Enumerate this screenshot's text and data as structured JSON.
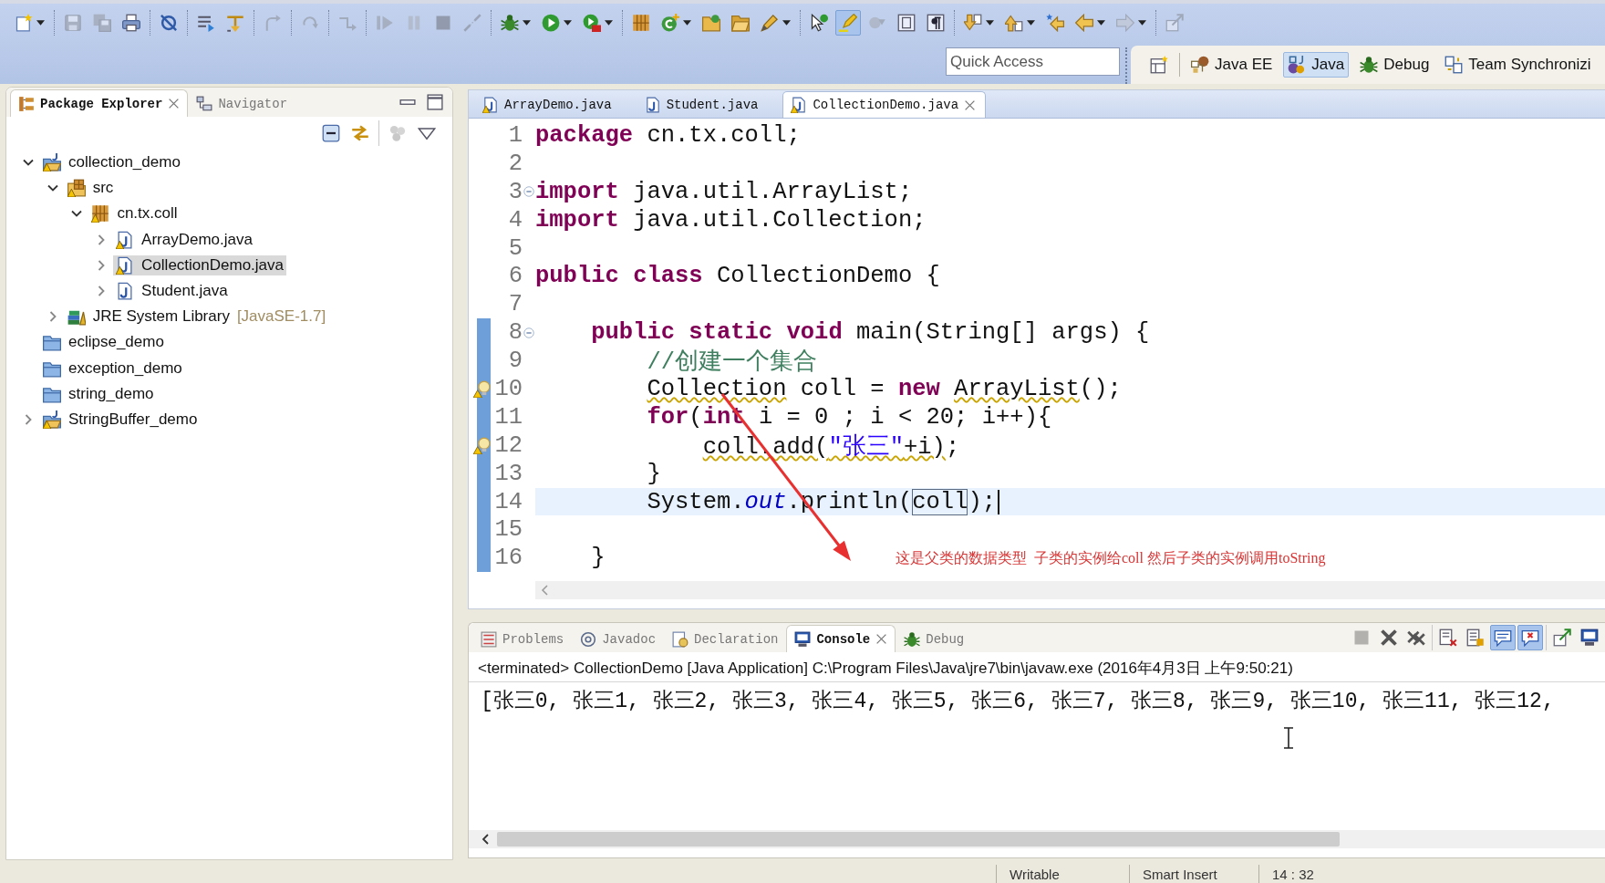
{
  "toolbar": {
    "groups": [
      [
        {
          "kind": "new",
          "dropdown": true,
          "disabled": false,
          "selected": false
        }
      ],
      [
        {
          "kind": "save",
          "dropdown": false,
          "disabled": true,
          "selected": false
        },
        {
          "kind": "save_all",
          "dropdown": false,
          "disabled": true,
          "selected": false
        },
        {
          "kind": "print",
          "dropdown": false,
          "disabled": false,
          "selected": false
        }
      ],
      [
        {
          "kind": "skip",
          "dropdown": false,
          "disabled": false,
          "selected": false
        }
      ],
      [
        {
          "kind": "lines",
          "dropdown": false,
          "disabled": false,
          "selected": false
        },
        {
          "kind": "branch",
          "dropdown": false,
          "disabled": false,
          "selected": false
        }
      ],
      [
        {
          "kind": "hook",
          "dropdown": false,
          "disabled": true,
          "selected": false
        }
      ],
      [
        {
          "kind": "redo",
          "dropdown": false,
          "disabled": true,
          "selected": false
        }
      ],
      [
        {
          "kind": "step_over",
          "dropdown": false,
          "disabled": true,
          "selected": false
        }
      ],
      [
        {
          "kind": "resume",
          "dropdown": false,
          "disabled": true,
          "selected": false
        },
        {
          "kind": "suspend",
          "dropdown": false,
          "disabled": true,
          "selected": false
        },
        {
          "kind": "stop",
          "dropdown": false,
          "disabled": true,
          "selected": false
        },
        {
          "kind": "disconnect",
          "dropdown": false,
          "disabled": true,
          "selected": false
        }
      ],
      [
        {
          "kind": "debug",
          "dropdown": true,
          "disabled": false,
          "selected": false
        },
        {
          "kind": "run",
          "dropdown": true,
          "disabled": false,
          "selected": false
        },
        {
          "kind": "tools",
          "dropdown": true,
          "disabled": false,
          "selected": false
        }
      ],
      [
        {
          "kind": "package",
          "dropdown": false,
          "disabled": false,
          "selected": false
        },
        {
          "kind": "class",
          "dropdown": true,
          "disabled": false,
          "selected": false
        },
        {
          "kind": "open_folder",
          "dropdown": false,
          "disabled": false,
          "selected": false
        },
        {
          "kind": "folder",
          "dropdown": false,
          "disabled": false,
          "selected": false
        },
        {
          "kind": "pen",
          "dropdown": true,
          "disabled": false,
          "selected": false
        }
      ],
      [
        {
          "kind": "pointer",
          "dropdown": false,
          "disabled": false,
          "selected": false
        },
        {
          "kind": "highlighter",
          "dropdown": false,
          "disabled": false,
          "selected": true
        },
        {
          "kind": "blob",
          "dropdown": false,
          "disabled": true,
          "selected": false
        },
        {
          "kind": "block",
          "dropdown": false,
          "disabled": false,
          "selected": false
        },
        {
          "kind": "pilcrow",
          "dropdown": false,
          "disabled": false,
          "selected": false
        }
      ],
      [
        {
          "kind": "down",
          "dropdown": true,
          "disabled": false,
          "selected": false
        },
        {
          "kind": "up",
          "dropdown": true,
          "disabled": false,
          "selected": false
        },
        {
          "kind": "back_star",
          "dropdown": false,
          "disabled": false,
          "selected": false
        },
        {
          "kind": "back",
          "dropdown": true,
          "disabled": false,
          "selected": false
        },
        {
          "kind": "forward",
          "dropdown": true,
          "disabled": true,
          "selected": false
        }
      ],
      [
        {
          "kind": "pin",
          "dropdown": false,
          "disabled": true,
          "selected": false
        }
      ]
    ]
  },
  "quick_access": {
    "placeholder": "Quick Access"
  },
  "perspectives": [
    {
      "kind": "javaee",
      "label": "Java EE",
      "selected": false
    },
    {
      "kind": "java",
      "label": "Java",
      "selected": true
    },
    {
      "kind": "debug",
      "label": "Debug",
      "selected": false
    },
    {
      "kind": "team",
      "label": "Team Synchronizi",
      "selected": false
    }
  ],
  "package_explorer": {
    "tabs": [
      {
        "kind": "packages",
        "label": "Package Explorer",
        "selected": true
      },
      {
        "kind": "navigator",
        "label": "Navigator",
        "selected": false
      }
    ],
    "toolbar": [
      [
        {
          "kind": "collapse",
          "disabled": false
        },
        {
          "kind": "link",
          "disabled": false
        }
      ],
      [
        {
          "kind": "filter",
          "disabled": true
        },
        {
          "kind": "view_menu",
          "disabled": false
        }
      ]
    ],
    "tree": [
      {
        "kind": "project",
        "label": "collection_demo",
        "expanded": true,
        "warning": true,
        "selected": false,
        "children": [
          {
            "kind": "source_folder",
            "label": "src",
            "expanded": true,
            "warning": true,
            "selected": false,
            "children": [
              {
                "kind": "package",
                "label": "cn.tx.coll",
                "expanded": true,
                "warning": true,
                "selected": false,
                "children": [
                  {
                    "kind": "java_file",
                    "label": "ArrayDemo.java",
                    "expanded": false,
                    "warning": true,
                    "selected": false
                  },
                  {
                    "kind": "java_file",
                    "label": "CollectionDemo.java",
                    "expanded": false,
                    "warning": true,
                    "selected": true
                  },
                  {
                    "kind": "java_file",
                    "label": "Student.java",
                    "expanded": false,
                    "warning": false,
                    "selected": false
                  }
                ]
              }
            ]
          },
          {
            "kind": "library",
            "label": "JRE System Library",
            "decoration": "[JavaSE-1.7]",
            "expanded": false,
            "warning": false,
            "selected": false
          }
        ]
      },
      {
        "kind": "closed_project",
        "label": "eclipse_demo",
        "warning": false,
        "selected": false
      },
      {
        "kind": "closed_project",
        "label": "exception_demo",
        "warning": false,
        "selected": false
      },
      {
        "kind": "closed_project",
        "label": "string_demo",
        "warning": false,
        "selected": false
      },
      {
        "kind": "project",
        "label": "StringBuffer_demo",
        "expanded": false,
        "warning": true,
        "selected": false
      }
    ]
  },
  "editor": {
    "tabs": [
      {
        "label": "ArrayDemo.java",
        "warning": true,
        "selected": false
      },
      {
        "label": "Student.java",
        "warning": false,
        "selected": false
      },
      {
        "label": "CollectionDemo.java",
        "warning": true,
        "selected": true
      }
    ],
    "lines": [
      {
        "number": "1",
        "changed": false,
        "warning": false,
        "fold": false,
        "current": false,
        "tokens": [
          {
            "kind": "keyword",
            "text": "package",
            "underlined": false
          },
          {
            "kind": "plain",
            "text": " cn.tx.coll;",
            "underlined": false
          }
        ]
      },
      {
        "number": "2",
        "changed": false,
        "warning": false,
        "fold": false,
        "current": false
      },
      {
        "number": "3",
        "changed": false,
        "warning": false,
        "fold": true,
        "current": false,
        "tokens": [
          {
            "kind": "keyword",
            "text": "import",
            "underlined": false
          },
          {
            "kind": "plain",
            "text": " java.util.ArrayList;",
            "underlined": false
          }
        ]
      },
      {
        "number": "4",
        "changed": false,
        "warning": false,
        "fold": false,
        "current": false,
        "tokens": [
          {
            "kind": "keyword",
            "text": "import",
            "underlined": false
          },
          {
            "kind": "plain",
            "text": " java.util.Collection;",
            "underlined": false
          }
        ]
      },
      {
        "number": "5",
        "changed": false,
        "warning": false,
        "fold": false,
        "current": false
      },
      {
        "number": "6",
        "changed": false,
        "warning": false,
        "fold": false,
        "current": false,
        "tokens": [
          {
            "kind": "keyword",
            "text": "public",
            "underlined": false
          },
          {
            "kind": "keyword",
            "text": " class",
            "underlined": false
          },
          {
            "kind": "plain",
            "text": " CollectionDemo {",
            "underlined": false
          }
        ]
      },
      {
        "number": "7",
        "changed": false,
        "warning": false,
        "fold": false,
        "current": false
      },
      {
        "number": "8",
        "changed": true,
        "warning": false,
        "fold": true,
        "current": false,
        "tokens": [
          {
            "kind": "keyword",
            "text": "    public",
            "underlined": false
          },
          {
            "kind": "keyword",
            "text": " static",
            "underlined": false
          },
          {
            "kind": "keyword",
            "text": " void",
            "underlined": false
          },
          {
            "kind": "plain",
            "text": " main(String[] args) {",
            "underlined": false
          }
        ]
      },
      {
        "number": "9",
        "changed": true,
        "warning": false,
        "fold": false,
        "current": false,
        "tokens": [
          {
            "kind": "comment",
            "text": "        //创建一个集合",
            "underlined": false
          }
        ]
      },
      {
        "number": "10",
        "changed": true,
        "warning": true,
        "fold": false,
        "current": false,
        "tokens": [
          {
            "kind": "plain",
            "text": "        Collection",
            "underlined": true
          },
          {
            "kind": "plain",
            "text": " coll = ",
            "underlined": false
          },
          {
            "kind": "keyword",
            "text": "new ",
            "underlined": false
          },
          {
            "kind": "plain",
            "text": "ArrayList",
            "underlined": true
          },
          {
            "kind": "plain",
            "text": "();",
            "underlined": false
          }
        ]
      },
      {
        "number": "11",
        "changed": true,
        "warning": false,
        "fold": false,
        "current": false,
        "tokens": [
          {
            "kind": "keyword",
            "text": "        for",
            "underlined": false
          },
          {
            "kind": "plain",
            "text": "(",
            "underlined": false
          },
          {
            "kind": "keyword",
            "text": "int",
            "underlined": false
          },
          {
            "kind": "plain",
            "text": " i = 0 ; i < 20; i++){",
            "underlined": false
          }
        ]
      },
      {
        "number": "12",
        "changed": true,
        "warning": true,
        "fold": false,
        "current": false,
        "tokens": [
          {
            "kind": "plain",
            "text": "            coll.add(",
            "underlined": true
          },
          {
            "kind": "string",
            "text": "\"张三\"",
            "underlined": true
          },
          {
            "kind": "plain",
            "text": "+i)",
            "underlined": true
          },
          {
            "kind": "plain",
            "text": ";",
            "underlined": false
          }
        ]
      },
      {
        "number": "13",
        "changed": true,
        "warning": false,
        "fold": false,
        "current": false,
        "tokens": [
          {
            "kind": "plain",
            "text": "        }",
            "underlined": false
          }
        ]
      },
      {
        "number": "14",
        "changed": true,
        "warning": false,
        "fold": false,
        "current": true,
        "tokens": [
          {
            "kind": "plain",
            "text": "        System.",
            "underlined": false
          },
          {
            "kind": "field",
            "text": "out",
            "underlined": false
          },
          {
            "kind": "plain",
            "text": ".println(",
            "underlined": false
          },
          {
            "kind": "occurrence",
            "text": "coll",
            "underlined": false
          },
          {
            "kind": "plain",
            "text": ");",
            "underlined": false
          }
        ]
      },
      {
        "number": "15",
        "changed": true,
        "warning": false,
        "fold": false,
        "current": false
      },
      {
        "number": "16",
        "changed": true,
        "warning": false,
        "fold": false,
        "current": false,
        "tokens": [
          {
            "kind": "plain",
            "text": "    }",
            "underlined": false
          }
        ]
      }
    ],
    "annotation": "这是父类的数据类型  子类的实例给coll 然后子类的实例调用toString"
  },
  "console": {
    "tabs": [
      {
        "kind": "problems",
        "label": "Problems",
        "selected": false
      },
      {
        "kind": "javadoc",
        "label": "Javadoc",
        "selected": false
      },
      {
        "kind": "declaration",
        "label": "Declaration",
        "selected": false
      },
      {
        "kind": "console",
        "label": "Console",
        "selected": true
      },
      {
        "kind": "debug",
        "label": "Debug",
        "selected": false
      }
    ],
    "toolbar": [
      [
        {
          "kind": "stop",
          "disabled": true,
          "selected": false
        },
        {
          "kind": "remove",
          "disabled": false,
          "selected": false
        },
        {
          "kind": "remove_all",
          "disabled": false,
          "selected": false
        }
      ],
      [
        {
          "kind": "clear",
          "disabled": false,
          "selected": false
        },
        {
          "kind": "scroll_lock",
          "disabled": false,
          "selected": false
        },
        {
          "kind": "show_out",
          "disabled": false,
          "selected": true
        },
        {
          "kind": "show_err",
          "disabled": false,
          "selected": true
        }
      ],
      [
        {
          "kind": "pin",
          "disabled": false,
          "selected": false
        },
        {
          "kind": "console",
          "disabled": false,
          "selected": false
        }
      ]
    ],
    "header": "<terminated> CollectionDemo [Java Application] C:\\Program Files\\Java\\jre7\\bin\\javaw.exe (2016年4月3日 上午9:50:21)",
    "output": "[张三0, 张三1, 张三2, 张三3, 张三4, 张三5, 张三6, 张三7, 张三8, 张三9, 张三10, 张三11, 张三12,"
  },
  "status_bar": [
    "Writable",
    "Smart Insert",
    "14 : 32"
  ]
}
